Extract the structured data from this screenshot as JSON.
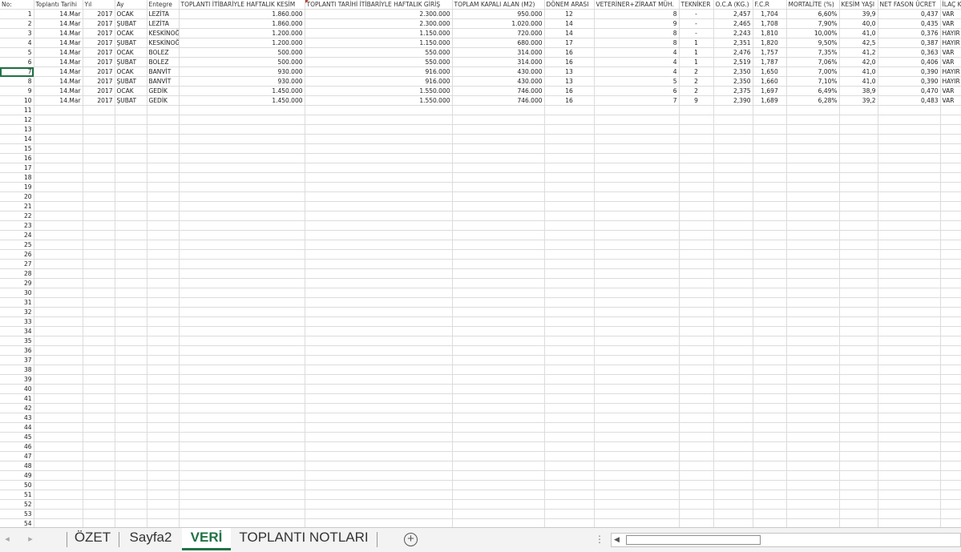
{
  "sheet": {
    "headers": [
      "No:",
      "Toplantı Tarihi",
      "Yıl",
      "Ay",
      "Entegre",
      "TOPLANTI İTİBARİYLE HAFTALIK KESİM",
      "TOPLANTI TARİHİ İTİBARİYLE  HAFTALIK GİRİŞ",
      "TOPLAM KAPALI ALAN (M2)",
      "DÖNEM ARASI",
      "VETERİNER+ZİRAAT MÜH.",
      "TEKNİKER",
      "O.C.A (KG.)",
      "F.C.R",
      "MORTALİTE (%)",
      "KESİM YAŞI",
      "NET FASON ÜCRET",
      "İLAÇ K"
    ],
    "rows": [
      [
        "1",
        "14.Mar",
        "2017",
        "OCAK",
        "LEZİTA",
        "1.860.000",
        "2.300.000",
        "950.000",
        "12",
        "8",
        "-",
        "2,457",
        "1,704",
        "6,60%",
        "39,9",
        "0,437",
        "VAR"
      ],
      [
        "2",
        "14.Mar",
        "2017",
        "ŞUBAT",
        "LEZİTA",
        "1.860.000",
        "2.300.000",
        "1.020.000",
        "14",
        "9",
        "-",
        "2,465",
        "1,708",
        "7,90%",
        "40,0",
        "0,435",
        "VAR"
      ],
      [
        "3",
        "14.Mar",
        "2017",
        "OCAK",
        "KESKİNOĞ",
        "1.200.000",
        "1.150.000",
        "720.000",
        "14",
        "8",
        "-",
        "2,243",
        "1,810",
        "10,00%",
        "41,0",
        "0,376",
        "HAYIR"
      ],
      [
        "4",
        "14.Mar",
        "2017",
        "ŞUBAT",
        "KESKİNOĞ",
        "1.200.000",
        "1.150.000",
        "680.000",
        "17",
        "8",
        "1",
        "2,351",
        "1,820",
        "9,50%",
        "42,5",
        "0,387",
        "HAYIR"
      ],
      [
        "5",
        "14.Mar",
        "2017",
        "OCAK",
        "BOLEZ",
        "500.000",
        "550.000",
        "314.000",
        "16",
        "4",
        "1",
        "2,476",
        "1,757",
        "7,35%",
        "41,2",
        "0,363",
        "VAR"
      ],
      [
        "6",
        "14.Mar",
        "2017",
        "ŞUBAT",
        "BOLEZ",
        "500.000",
        "550.000",
        "314.000",
        "16",
        "4",
        "1",
        "2,519",
        "1,787",
        "7,06%",
        "42,0",
        "0,406",
        "VAR"
      ],
      [
        "7",
        "14.Mar",
        "2017",
        "OCAK",
        "BANVİT",
        "930.000",
        "916.000",
        "430.000",
        "13",
        "4",
        "2",
        "2,350",
        "1,650",
        "7,00%",
        "41,0",
        "0,390",
        "HAYIR"
      ],
      [
        "8",
        "14.Mar",
        "2017",
        "ŞUBAT",
        "BANVİT",
        "930.000",
        "916.000",
        "430.000",
        "13",
        "5",
        "2",
        "2,350",
        "1,660",
        "7,10%",
        "41,0",
        "0,390",
        "HAYIR"
      ],
      [
        "9",
        "14.Mar",
        "2017",
        "OCAK",
        "GEDİK",
        "1.450.000",
        "1.550.000",
        "746.000",
        "16",
        "6",
        "2",
        "2,375",
        "1,697",
        "6,49%",
        "38,9",
        "0,470",
        "VAR"
      ],
      [
        "10",
        "14.Mar",
        "2017",
        "ŞUBAT",
        "GEDİK",
        "1.450.000",
        "1.550.000",
        "746.000",
        "16",
        "7",
        "9",
        "2,390",
        "1,689",
        "6,28%",
        "39,2",
        "0,483",
        "VAR"
      ]
    ],
    "empty_row_numbers": [
      "11",
      "12",
      "13",
      "14",
      "15",
      "16",
      "17",
      "18",
      "19",
      "20",
      "21",
      "22",
      "23",
      "24",
      "25",
      "26",
      "27",
      "28",
      "29",
      "30",
      "31",
      "32",
      "33",
      "34",
      "35",
      "36",
      "37",
      "38",
      "39",
      "40",
      "41",
      "42",
      "43",
      "44",
      "45",
      "46",
      "47",
      "48",
      "49",
      "50",
      "51",
      "52",
      "53",
      "54"
    ]
  },
  "tabs": {
    "items": [
      "ÖZET",
      "Sayfa2",
      "VERİ",
      "TOPLANTI NOTLARI"
    ],
    "active": "VERİ",
    "nav_prev": "◂",
    "nav_next": "▸",
    "add": "+",
    "more": "⋮"
  },
  "scrollbar": {
    "left_arrow": "◀"
  },
  "colors": {
    "accent": "#217346",
    "grid": "#dcdcdc",
    "comment": "#c0392b"
  }
}
